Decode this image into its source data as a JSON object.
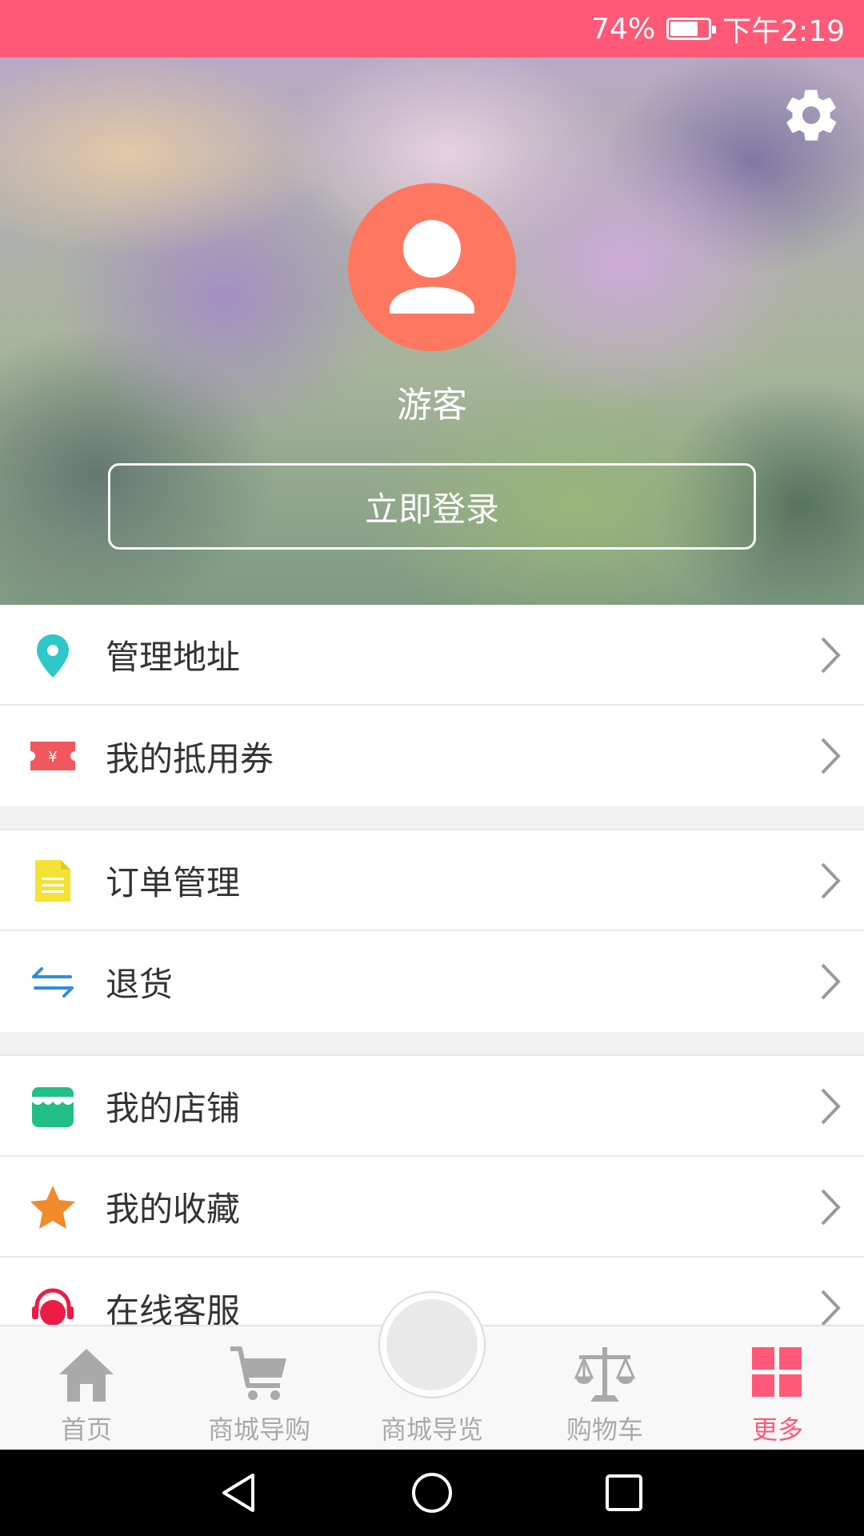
{
  "status_bar": {
    "battery": "74%",
    "battery_level": 0.74,
    "time": "下午2:19"
  },
  "header": {
    "username": "游客",
    "login_button": "立即登录",
    "settings_icon": "gear-icon",
    "avatar_icon": "user-icon"
  },
  "menu": [
    {
      "label": "管理地址",
      "icon": "location-pin-icon",
      "color": "#2ec8c8"
    },
    {
      "label": "我的抵用券",
      "icon": "coupon-icon",
      "color": "#f1585d"
    },
    {
      "label": "订单管理",
      "icon": "document-icon",
      "color": "#f4e235"
    },
    {
      "label": "退货",
      "icon": "return-arrows-icon",
      "color": "#2f8ee0"
    },
    {
      "label": "我的店铺",
      "icon": "store-icon",
      "color": "#21bf86"
    },
    {
      "label": "我的收藏",
      "icon": "star-icon",
      "color": "#f08a2b"
    },
    {
      "label": "在线客服",
      "icon": "headset-icon",
      "color": "#ec1b45"
    }
  ],
  "coupon_symbol": "¥",
  "tabbar": {
    "tabs": [
      {
        "label": "首页",
        "icon": "home-icon"
      },
      {
        "label": "商城导购",
        "icon": "cart-icon"
      },
      {
        "label": "商城导览",
        "icon": "circle-button-icon"
      },
      {
        "label": "购物车",
        "icon": "scale-icon"
      },
      {
        "label": "更多",
        "icon": "grid-icon",
        "active": true
      }
    ]
  },
  "colors": {
    "accent": "#fe5a78",
    "avatar_bg": "#fe7760",
    "inactive_tab": "#aaaaaa"
  }
}
